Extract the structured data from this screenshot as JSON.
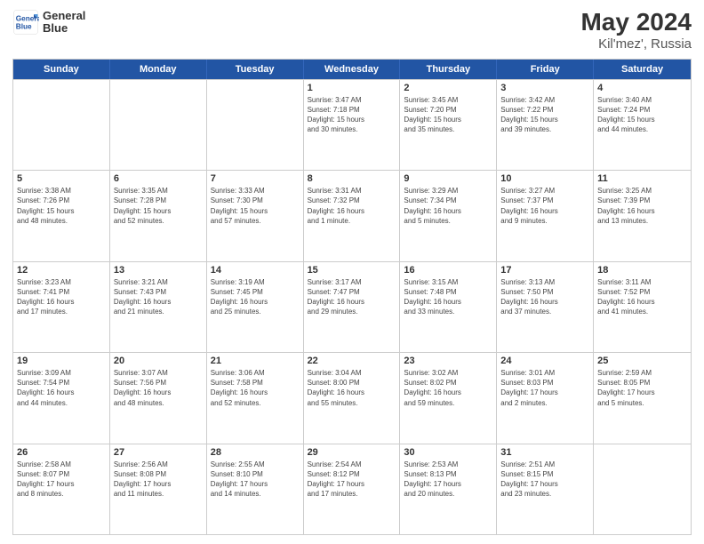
{
  "header": {
    "logo": {
      "line1": "General",
      "line2": "Blue"
    },
    "title": "May 2024",
    "location": "Kil'mez', Russia"
  },
  "weekdays": [
    "Sunday",
    "Monday",
    "Tuesday",
    "Wednesday",
    "Thursday",
    "Friday",
    "Saturday"
  ],
  "weeks": [
    [
      {
        "date": "",
        "info": ""
      },
      {
        "date": "",
        "info": ""
      },
      {
        "date": "",
        "info": ""
      },
      {
        "date": "1",
        "info": "Sunrise: 3:47 AM\nSunset: 7:18 PM\nDaylight: 15 hours\nand 30 minutes."
      },
      {
        "date": "2",
        "info": "Sunrise: 3:45 AM\nSunset: 7:20 PM\nDaylight: 15 hours\nand 35 minutes."
      },
      {
        "date": "3",
        "info": "Sunrise: 3:42 AM\nSunset: 7:22 PM\nDaylight: 15 hours\nand 39 minutes."
      },
      {
        "date": "4",
        "info": "Sunrise: 3:40 AM\nSunset: 7:24 PM\nDaylight: 15 hours\nand 44 minutes."
      }
    ],
    [
      {
        "date": "5",
        "info": "Sunrise: 3:38 AM\nSunset: 7:26 PM\nDaylight: 15 hours\nand 48 minutes."
      },
      {
        "date": "6",
        "info": "Sunrise: 3:35 AM\nSunset: 7:28 PM\nDaylight: 15 hours\nand 52 minutes."
      },
      {
        "date": "7",
        "info": "Sunrise: 3:33 AM\nSunset: 7:30 PM\nDaylight: 15 hours\nand 57 minutes."
      },
      {
        "date": "8",
        "info": "Sunrise: 3:31 AM\nSunset: 7:32 PM\nDaylight: 16 hours\nand 1 minute."
      },
      {
        "date": "9",
        "info": "Sunrise: 3:29 AM\nSunset: 7:34 PM\nDaylight: 16 hours\nand 5 minutes."
      },
      {
        "date": "10",
        "info": "Sunrise: 3:27 AM\nSunset: 7:37 PM\nDaylight: 16 hours\nand 9 minutes."
      },
      {
        "date": "11",
        "info": "Sunrise: 3:25 AM\nSunset: 7:39 PM\nDaylight: 16 hours\nand 13 minutes."
      }
    ],
    [
      {
        "date": "12",
        "info": "Sunrise: 3:23 AM\nSunset: 7:41 PM\nDaylight: 16 hours\nand 17 minutes."
      },
      {
        "date": "13",
        "info": "Sunrise: 3:21 AM\nSunset: 7:43 PM\nDaylight: 16 hours\nand 21 minutes."
      },
      {
        "date": "14",
        "info": "Sunrise: 3:19 AM\nSunset: 7:45 PM\nDaylight: 16 hours\nand 25 minutes."
      },
      {
        "date": "15",
        "info": "Sunrise: 3:17 AM\nSunset: 7:47 PM\nDaylight: 16 hours\nand 29 minutes."
      },
      {
        "date": "16",
        "info": "Sunrise: 3:15 AM\nSunset: 7:48 PM\nDaylight: 16 hours\nand 33 minutes."
      },
      {
        "date": "17",
        "info": "Sunrise: 3:13 AM\nSunset: 7:50 PM\nDaylight: 16 hours\nand 37 minutes."
      },
      {
        "date": "18",
        "info": "Sunrise: 3:11 AM\nSunset: 7:52 PM\nDaylight: 16 hours\nand 41 minutes."
      }
    ],
    [
      {
        "date": "19",
        "info": "Sunrise: 3:09 AM\nSunset: 7:54 PM\nDaylight: 16 hours\nand 44 minutes."
      },
      {
        "date": "20",
        "info": "Sunrise: 3:07 AM\nSunset: 7:56 PM\nDaylight: 16 hours\nand 48 minutes."
      },
      {
        "date": "21",
        "info": "Sunrise: 3:06 AM\nSunset: 7:58 PM\nDaylight: 16 hours\nand 52 minutes."
      },
      {
        "date": "22",
        "info": "Sunrise: 3:04 AM\nSunset: 8:00 PM\nDaylight: 16 hours\nand 55 minutes."
      },
      {
        "date": "23",
        "info": "Sunrise: 3:02 AM\nSunset: 8:02 PM\nDaylight: 16 hours\nand 59 minutes."
      },
      {
        "date": "24",
        "info": "Sunrise: 3:01 AM\nSunset: 8:03 PM\nDaylight: 17 hours\nand 2 minutes."
      },
      {
        "date": "25",
        "info": "Sunrise: 2:59 AM\nSunset: 8:05 PM\nDaylight: 17 hours\nand 5 minutes."
      }
    ],
    [
      {
        "date": "26",
        "info": "Sunrise: 2:58 AM\nSunset: 8:07 PM\nDaylight: 17 hours\nand 8 minutes."
      },
      {
        "date": "27",
        "info": "Sunrise: 2:56 AM\nSunset: 8:08 PM\nDaylight: 17 hours\nand 11 minutes."
      },
      {
        "date": "28",
        "info": "Sunrise: 2:55 AM\nSunset: 8:10 PM\nDaylight: 17 hours\nand 14 minutes."
      },
      {
        "date": "29",
        "info": "Sunrise: 2:54 AM\nSunset: 8:12 PM\nDaylight: 17 hours\nand 17 minutes."
      },
      {
        "date": "30",
        "info": "Sunrise: 2:53 AM\nSunset: 8:13 PM\nDaylight: 17 hours\nand 20 minutes."
      },
      {
        "date": "31",
        "info": "Sunrise: 2:51 AM\nSunset: 8:15 PM\nDaylight: 17 hours\nand 23 minutes."
      },
      {
        "date": "",
        "info": ""
      }
    ]
  ]
}
